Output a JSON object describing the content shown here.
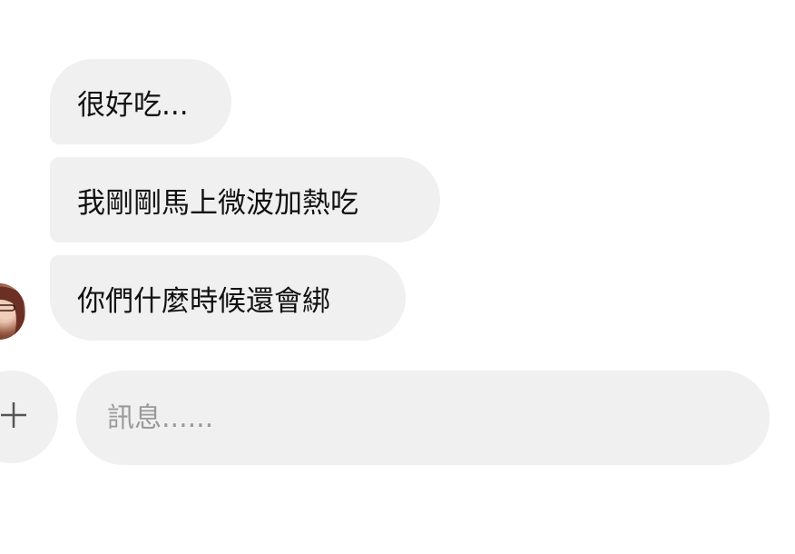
{
  "messages": [
    {
      "sender": "other",
      "text": "很好吃..."
    },
    {
      "sender": "other",
      "text": "我剛剛馬上微波加熱吃"
    },
    {
      "sender": "other",
      "text": "你們什麼時候還會綁"
    }
  ],
  "composer": {
    "placeholder": "訊息......",
    "value": ""
  },
  "icons": {
    "add": "plus-icon",
    "avatar": "user-avatar"
  },
  "colors": {
    "bubble_bg": "#f0f0f0",
    "text": "#111111",
    "placeholder": "#9a9a9a",
    "background": "#ffffff"
  }
}
